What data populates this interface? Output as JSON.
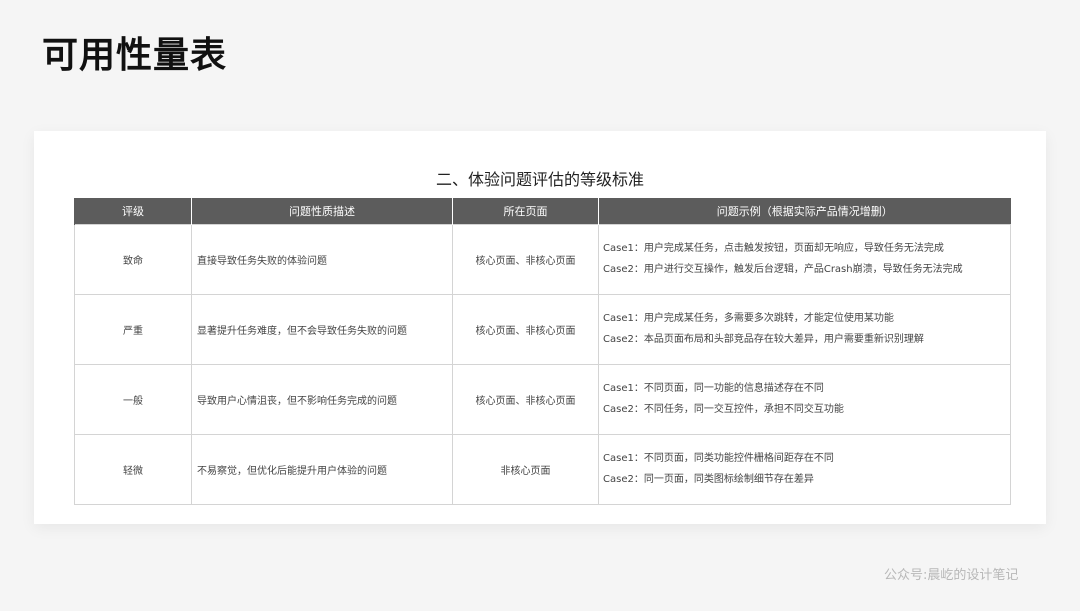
{
  "page_title": "可用性量表",
  "table": {
    "title": "二、体验问题评估的等级标准",
    "headers": [
      "评级",
      "问题性质描述",
      "所在页面",
      "问题示例（根据实际产品情况增删）"
    ],
    "rows": [
      {
        "level": "致命",
        "description": "直接导致任务失败的体验问题",
        "pages": "核心页面、非核心页面",
        "cases": [
          "Case1：用户完成某任务，点击触发按钮，页面却无响应，导致任务无法完成",
          "Case2：用户进行交互操作，触发后台逻辑，产品Crash崩溃，导致任务无法完成"
        ]
      },
      {
        "level": "严重",
        "description": "显著提升任务难度，但不会导致任务失败的问题",
        "pages": "核心页面、非核心页面",
        "cases": [
          "Case1：用户完成某任务，多需要多次跳转，才能定位使用某功能",
          "Case2：本品页面布局和头部竞品存在较大差异，用户需要重新识别理解"
        ]
      },
      {
        "level": "一般",
        "description": "导致用户心情沮丧，但不影响任务完成的问题",
        "pages": "核心页面、非核心页面",
        "cases": [
          "Case1：不同页面，同一功能的信息描述存在不同",
          "Case2：不同任务，同一交互控件，承担不同交互功能"
        ]
      },
      {
        "level": "轻微",
        "description": "不易察觉，但优化后能提升用户体验的问题",
        "pages": "非核心页面",
        "cases": [
          "Case1：不同页面，同类功能控件栅格间距存在不同",
          "Case2：同一页面，同类图标绘制细节存在差异"
        ]
      }
    ]
  },
  "watermark": "公众号:晨屹的设计笔记"
}
